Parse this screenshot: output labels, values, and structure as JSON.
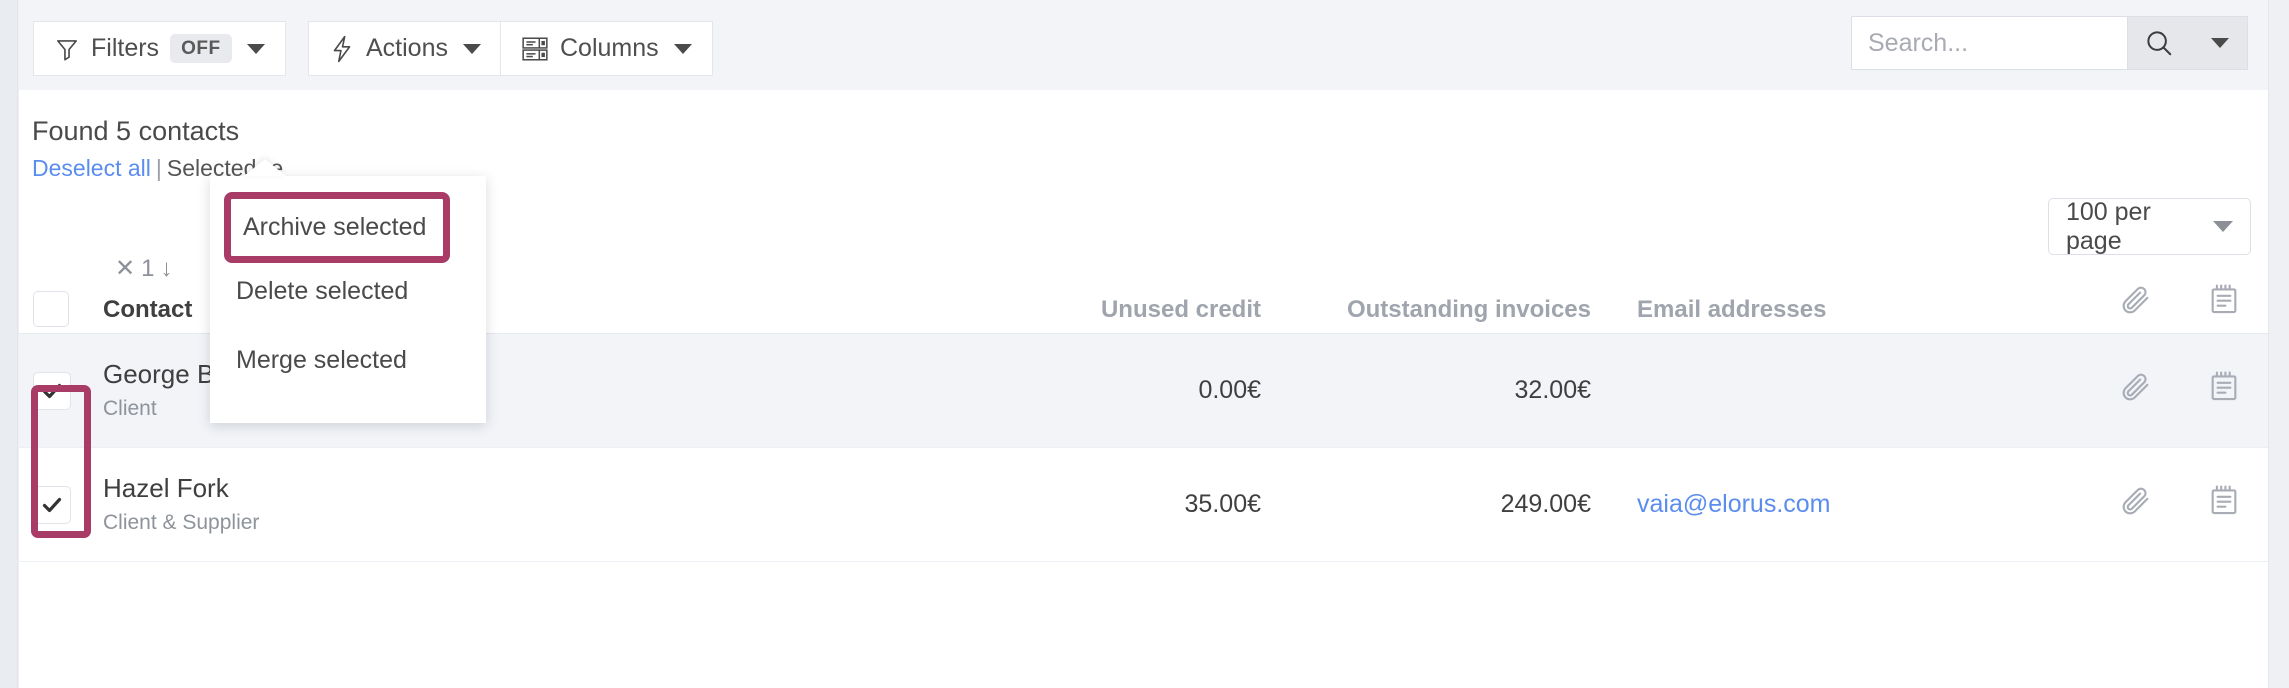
{
  "toolbar": {
    "filters": {
      "label": "Filters",
      "state_badge": "OFF",
      "icon": "funnel-icon"
    },
    "actions": {
      "label": "Actions",
      "icon": "lightning-bolt-icon"
    },
    "columns": {
      "label": "Columns",
      "icon": "columns-icon"
    },
    "search": {
      "placeholder": "Search...",
      "value": "",
      "icon": "search-icon"
    }
  },
  "actions_menu": {
    "items": [
      {
        "label": "Archive selected",
        "highlighted": true
      },
      {
        "label": "Delete selected",
        "highlighted": false
      },
      {
        "label": "Merge selected",
        "highlighted": false
      }
    ]
  },
  "results": {
    "found_label": "Found 5 contacts",
    "deselect_all": "Deselect all",
    "separator": "|",
    "selected_text": "Selected re"
  },
  "per_page": {
    "value": "100 per page"
  },
  "sort_indicator": {
    "clear": "✕",
    "order": "1",
    "direction": "↓"
  },
  "table": {
    "headers": {
      "contact": "Contact",
      "unused_credit": "Unused credit",
      "outstanding_invoices": "Outstanding invoices",
      "email_addresses": "Email addresses",
      "attachments_icon": "paperclip-icon",
      "notes_icon": "notepad-icon"
    },
    "rows": [
      {
        "checked": true,
        "name": "George B",
        "type": "Client",
        "unused_credit": "0.00€",
        "outstanding_invoices": "32.00€",
        "email": "",
        "attachment_icon": "paperclip-icon",
        "note_icon": "notepad-icon"
      },
      {
        "checked": true,
        "name": "Hazel Fork",
        "type": "Client & Supplier",
        "unused_credit": "35.00€",
        "outstanding_invoices": "249.00€",
        "email": "vaia@elorus.com",
        "attachment_icon": "paperclip-icon",
        "note_icon": "notepad-icon"
      }
    ]
  },
  "colors": {
    "highlight": "#a93b67",
    "link": "#5b8def",
    "toolbar_bg": "#f2f4f7",
    "row_alt_bg": "#f2f4f8"
  }
}
